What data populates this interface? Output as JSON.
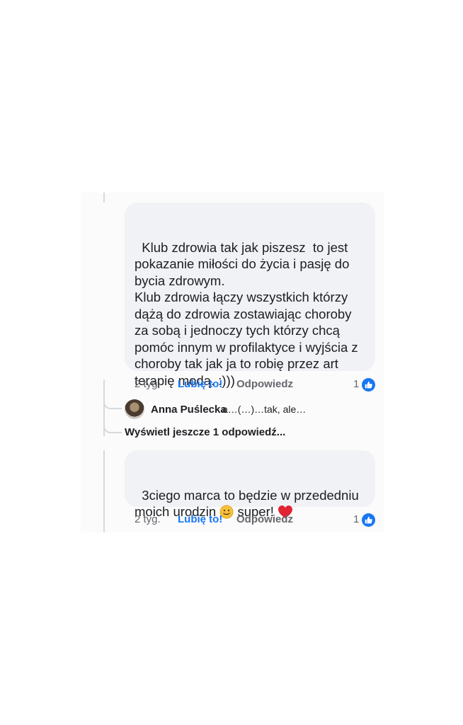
{
  "comments": [
    {
      "text": "Klub zdrowia tak jak piszesz  to jest pokazanie miłości do życia i pasję do bycia zdrowym.\nKlub zdrowia łączy wszystkich którzy dążą do zdrowia zostawiając choroby za sobą i jednoczy tych którzy chcą pomóc innym w profilaktyce i wyjścia z choroby tak jak ja to robię przez art terapię modą. :)))",
      "time": "2 tyg.",
      "like_label": "Lubię to!",
      "reply_label": "Odpowiedz",
      "like_count": "1"
    },
    {
      "text_before": "3ciego marca to będzie w przededniu moich urodzin ",
      "text_mid": " super! ",
      "emoji_1": "slightly-smiling-face-icon",
      "emoji_2": "red-heart-icon",
      "time": "2 tyg.",
      "like_label": "Lubię to!",
      "reply_label": "Odpowiedz",
      "like_count": "1"
    }
  ],
  "reply": {
    "author": "Anna Puślecka",
    "snippet": "a…(…)…tak, ale…"
  },
  "view_more_label": "Wyświetl jeszcze 1 odpowiedź...",
  "colors": {
    "bubble": "#f0f2f5",
    "like_blue": "#1877f2",
    "muted": "#65676b",
    "text": "#1c1e21"
  }
}
